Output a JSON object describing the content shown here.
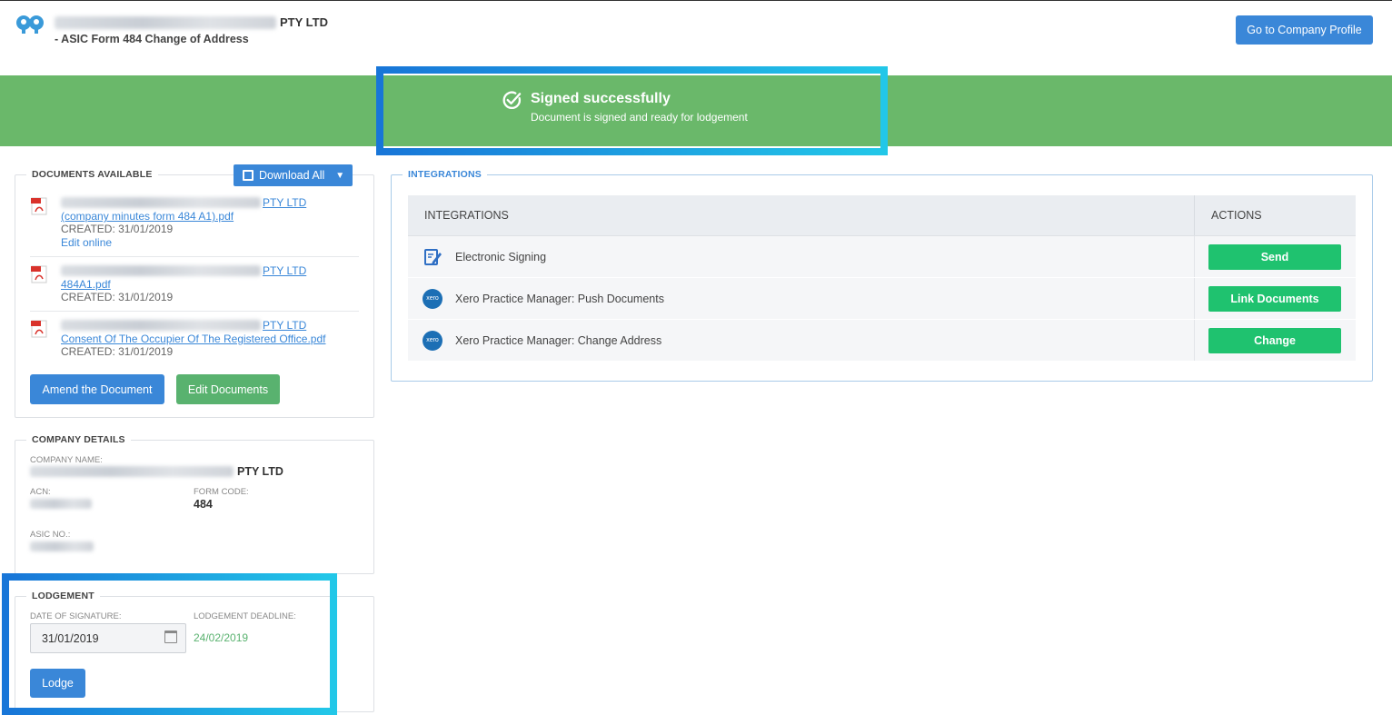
{
  "header": {
    "company_suffix": "PTY LTD",
    "subtitle": "- ASIC Form 484 Change of Address",
    "profile_button": "Go to Company Profile"
  },
  "banner": {
    "title": "Signed successfully",
    "subtitle": "Document is signed and ready for lodgement"
  },
  "documents": {
    "legend": "DOCUMENTS AVAILABLE",
    "download_all": "Download All",
    "items": [
      {
        "title_suffix": "PTY LTD",
        "filename": "(company minutes form 484 A1).pdf",
        "created": "CREATED: 31/01/2019",
        "edit": "Edit online"
      },
      {
        "title_suffix": "PTY LTD",
        "filename": "484A1.pdf",
        "created": "CREATED: 31/01/2019"
      },
      {
        "title_suffix": "PTY LTD",
        "filename": "Consent Of The Occupier Of The Registered Office.pdf",
        "created": "CREATED: 31/01/2019"
      }
    ],
    "amend_button": "Amend the Document",
    "edit_button": "Edit Documents"
  },
  "company": {
    "legend": "COMPANY DETAILS",
    "name_label": "COMPANY NAME:",
    "name_suffix": "PTY LTD",
    "acn_label": "ACN:",
    "form_code_label": "FORM CODE:",
    "form_code": "484",
    "asic_label": "ASIC NO.:"
  },
  "lodgement": {
    "legend": "LODGEMENT",
    "date_label": "DATE OF SIGNATURE:",
    "date_value": "31/01/2019",
    "deadline_label": "LODGEMENT DEADLINE:",
    "deadline_value": "24/02/2019",
    "lodge_button": "Lodge"
  },
  "integrations": {
    "legend": "INTEGRATIONS",
    "col_integrations": "INTEGRATIONS",
    "col_actions": "ACTIONS",
    "rows": [
      {
        "name": "Electronic Signing",
        "icon": "signing-icon",
        "action": "Send"
      },
      {
        "name": "Xero Practice Manager: Push Documents",
        "icon": "xero-icon",
        "icon_text": "xero",
        "action": "Link Documents"
      },
      {
        "name": "Xero Practice Manager: Change Address",
        "icon": "xero-icon",
        "icon_text": "xero",
        "action": "Change"
      }
    ]
  },
  "colors": {
    "primary": "#3a87d8",
    "success_banner": "#6ab86a",
    "action_green": "#1fc26f",
    "highlight_start": "#1876d8",
    "highlight_end": "#22c7e8"
  }
}
